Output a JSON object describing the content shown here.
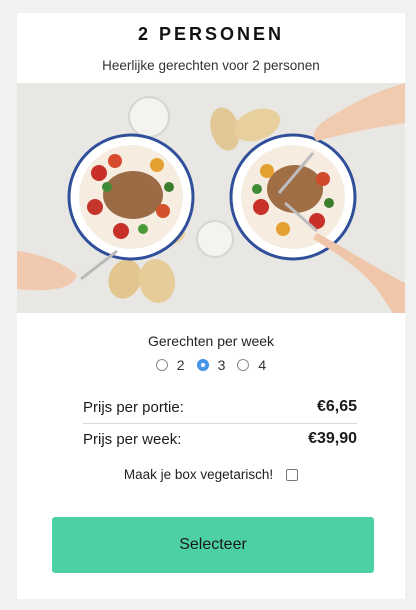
{
  "plan": {
    "title": "2 PERSONEN",
    "subtitle": "Heerlijke gerechten voor 2 personen"
  },
  "meals": {
    "label": "Gerechten per week",
    "options": [
      "2",
      "3",
      "4"
    ],
    "selected": "3"
  },
  "pricing": {
    "per_portion_label": "Prijs per portie:",
    "per_portion_value": "€6,65",
    "per_week_label": "Prijs per week:",
    "per_week_value": "€39,90"
  },
  "vegetarian": {
    "label": "Maak je box vegetarisch!",
    "checked": false
  },
  "cta": {
    "label": "Selecteer"
  },
  "colors": {
    "accent": "#4dd1a3",
    "radio_selected": "#4a98ea"
  }
}
